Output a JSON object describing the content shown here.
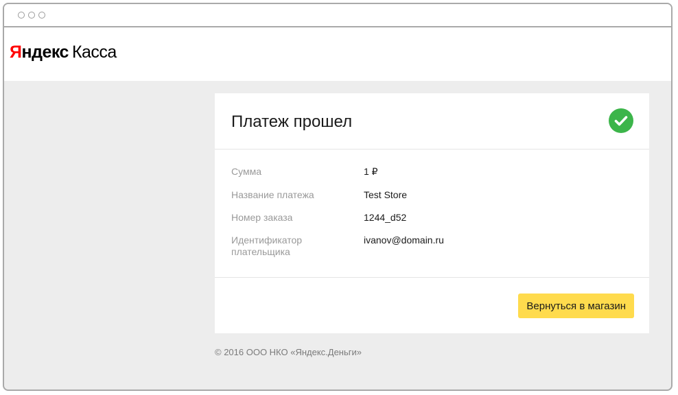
{
  "header": {
    "logo_brand_first": "Я",
    "logo_brand_rest": "ндекс",
    "logo_product": "Касса"
  },
  "card": {
    "title": "Платеж прошел",
    "status_icon": "check-circle-icon",
    "details": [
      {
        "label": "Сумма",
        "value": "1 ₽"
      },
      {
        "label": "Название платежа",
        "value": "Test Store"
      },
      {
        "label": "Номер заказа",
        "value": "1244_d52"
      },
      {
        "label": "Идентификатор плательщика",
        "value": "ivanov@domain.ru"
      }
    ],
    "return_button_label": "Вернуться в магазин"
  },
  "footer": {
    "copyright": "© 2016 ООО НКО «Яндекс.Деньги»"
  },
  "colors": {
    "accent_button": "#ffdb4d",
    "success": "#3cb54a",
    "brand_red": "#ff0000",
    "page_background": "#ededed"
  }
}
